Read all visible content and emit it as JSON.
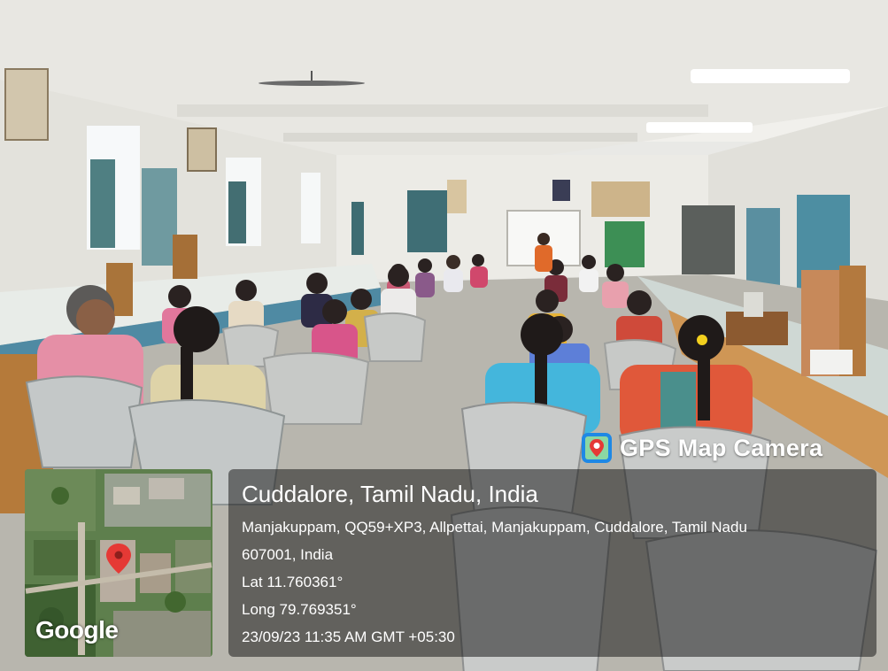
{
  "watermark": {
    "brand": "GPS Map Camera",
    "icon": "gps-pin-icon",
    "map_attribution": "Google"
  },
  "location": {
    "title": "Cuddalore, Tamil Nadu, India",
    "address_line1": "Manjakuppam, QQ59+XP3, Allpettai, Manjakuppam, Cuddalore, Tamil Nadu",
    "address_line2": "607001, India",
    "latitude": "Lat 11.760361°",
    "longitude": "Long 79.769351°",
    "timestamp": "23/09/23 11:35 AM GMT +05:30"
  },
  "colors": {
    "panel_bg": "rgba(20,20,20,0.52)",
    "map_pin": "#e53935",
    "badge_blue": "#1e88e5"
  }
}
